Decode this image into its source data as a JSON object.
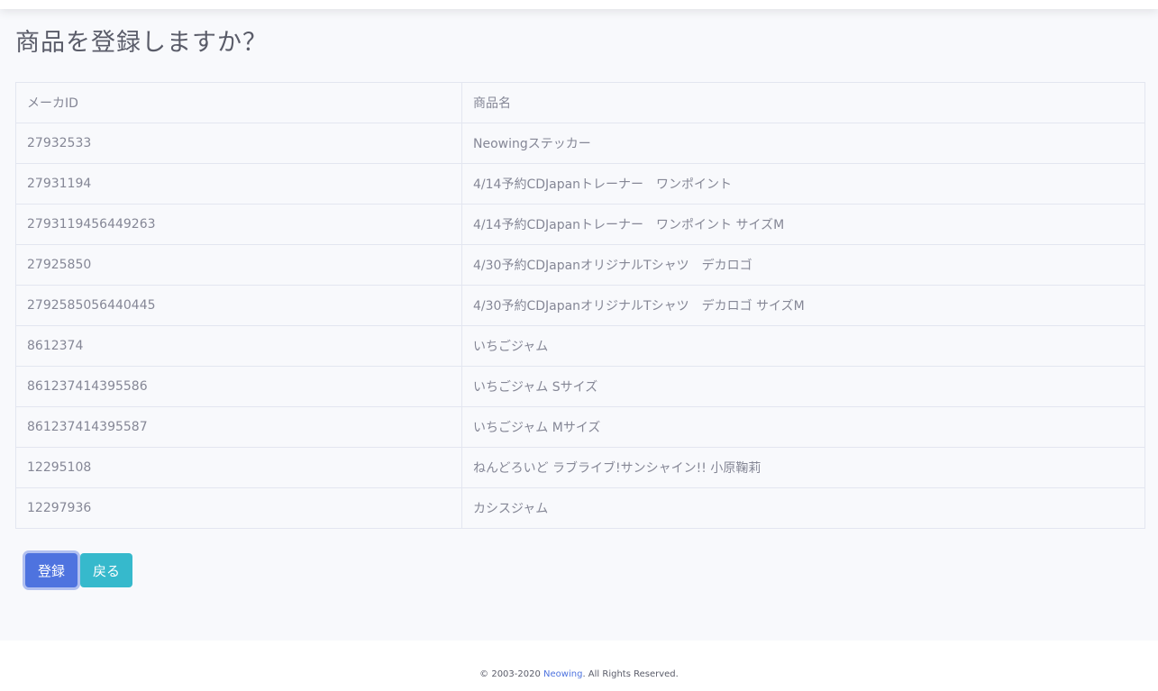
{
  "page": {
    "title": "商品を登録しますか？"
  },
  "table": {
    "headers": [
      "メーカID",
      "商品名"
    ],
    "rows": [
      [
        "27932533",
        "Neowingステッカー"
      ],
      [
        "27931194",
        "4/14予約CDJapanトレーナー　ワンポイント"
      ],
      [
        "2793119456449263",
        "4/14予約CDJapanトレーナー　ワンポイント サイズM"
      ],
      [
        "27925850",
        "4/30予約CDJapanオリジナルTシャツ　デカロゴ"
      ],
      [
        "2792585056440445",
        "4/30予約CDJapanオリジナルTシャツ　デカロゴ サイズM"
      ],
      [
        "8612374",
        "いちごジャム"
      ],
      [
        "861237414395586",
        "いちごジャム Sサイズ"
      ],
      [
        "861237414395587",
        "いちごジャム Mサイズ"
      ],
      [
        "12295108",
        "ねんどろいど ラブライブ!サンシャイン!! 小原鞠莉"
      ],
      [
        "12297936",
        "カシスジャム"
      ]
    ]
  },
  "buttons": {
    "register_label": "登録",
    "back_label": "戻る"
  },
  "footer": {
    "copyright_prefix": "© 2003-2020 ",
    "brand_link": "Neowing",
    "copyright_suffix": ". All Rights Reserved."
  },
  "colors": {
    "primary": "#4e73df",
    "info": "#36b9cc",
    "background": "#f8f9fc",
    "border": "#e3e6f0",
    "text": "#858796"
  }
}
